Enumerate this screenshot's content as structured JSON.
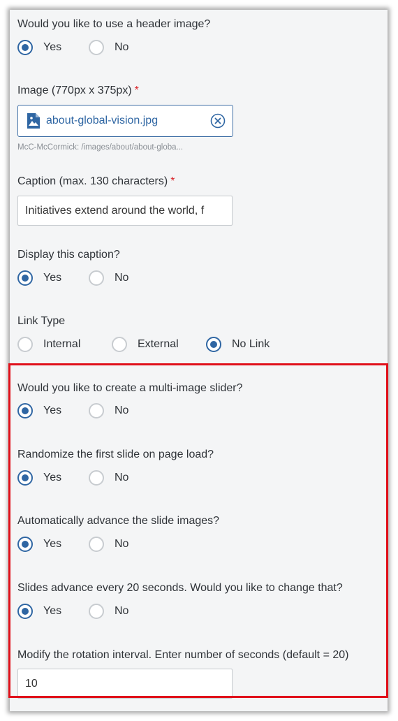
{
  "header_image": {
    "question": "Would you like to use a header image?",
    "options": [
      "Yes",
      "No"
    ],
    "selected": "Yes"
  },
  "image": {
    "label": "Image (770px x 375px)",
    "required_mark": "*",
    "file_name": "about-global-vision.jpg",
    "path": "McC-McCormick: /images/about/about-globa..."
  },
  "caption": {
    "label": "Caption (max. 130 characters)",
    "required_mark": "*",
    "value": "Initiatives extend around the world, f"
  },
  "display_caption": {
    "question": "Display this caption?",
    "options": [
      "Yes",
      "No"
    ],
    "selected": "Yes"
  },
  "link_type": {
    "question": "Link Type",
    "options": [
      "Internal",
      "External",
      "No Link"
    ],
    "selected": "No Link"
  },
  "slider": {
    "question": "Would you like to create a multi-image slider?",
    "options": [
      "Yes",
      "No"
    ],
    "selected": "Yes"
  },
  "randomize": {
    "question": "Randomize the first slide on page load?",
    "options": [
      "Yes",
      "No"
    ],
    "selected": "Yes"
  },
  "auto_advance": {
    "question": "Automatically advance the slide images?",
    "options": [
      "Yes",
      "No"
    ],
    "selected": "Yes"
  },
  "change_interval": {
    "question": "Slides advance every 20 seconds. Would you like to change that?",
    "options": [
      "Yes",
      "No"
    ],
    "selected": "Yes"
  },
  "rotation_interval": {
    "label": "Modify the rotation interval. Enter number of seconds (default = 20)",
    "value": "10"
  },
  "colors": {
    "accent": "#2f66a3",
    "required": "#d9252a",
    "highlight_border": "#e0101a",
    "panel_bg": "#f4f5f6"
  },
  "icons": {
    "file": "image-file-icon",
    "clear": "clear-circle-x-icon"
  }
}
